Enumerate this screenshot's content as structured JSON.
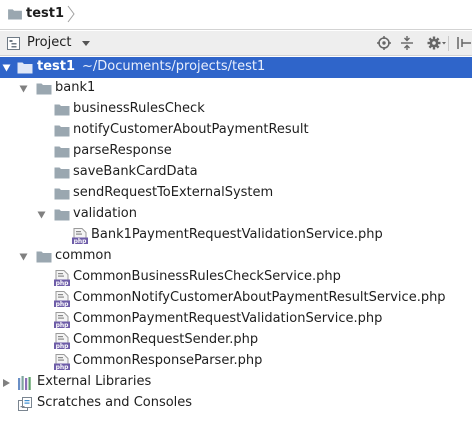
{
  "breadcrumb": {
    "project": "test1"
  },
  "toolbar": {
    "title": "Project"
  },
  "tree": {
    "root": {
      "name": "test1",
      "path": "~/Documents/projects/test1"
    },
    "bank1": {
      "name": "bank1",
      "folders": [
        "businessRulesCheck",
        "notifyCustomerAboutPaymentResult",
        "parseResponse",
        "saveBankCardData",
        "sendRequestToExternalSystem"
      ],
      "validation": {
        "name": "validation",
        "files": [
          "Bank1PaymentRequestValidationService.php"
        ]
      }
    },
    "common": {
      "name": "common",
      "files": [
        "CommonBusinessRulesCheckService.php",
        "CommonNotifyCustomerAboutPaymentResultService.php",
        "CommonPaymentRequestValidationService.php",
        "CommonRequestSender.php",
        "CommonResponseParser.php"
      ]
    },
    "external_libraries": "External Libraries",
    "scratches": "Scratches and Consoles"
  },
  "colors": {
    "selection": "#2f65ca",
    "folder": "#9aa7b0",
    "php": "#6e5da8"
  },
  "icons": {
    "folder": "folder-icon",
    "php": "php-file-icon",
    "libraries": "library-icon",
    "scratches": "scratches-icon"
  }
}
